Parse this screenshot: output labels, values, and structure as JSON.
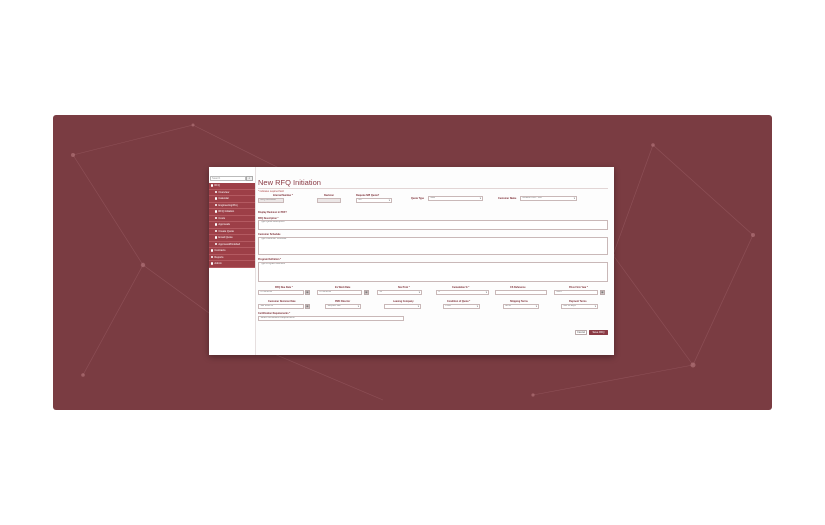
{
  "sidebar": {
    "search_placeholder": "Search",
    "search_icon": "search-icon",
    "items": [
      {
        "label": "RFQ",
        "top": true
      },
      {
        "label": "Overview",
        "top": false
      },
      {
        "label": "Calendar",
        "top": false
      },
      {
        "label": "Engineering/Proj",
        "top": false
      },
      {
        "label": "RFQ Initiation",
        "top": false
      },
      {
        "label": "Costs",
        "top": false
      },
      {
        "label": "Approvals",
        "top": false
      },
      {
        "label": "Create Quote",
        "top": false
      },
      {
        "label": "Email Quote",
        "top": false
      },
      {
        "label": "Approved/Finished",
        "top": false
      },
      {
        "label": "Contracts",
        "top": true
      },
      {
        "label": "Reports",
        "top": true
      },
      {
        "label": "Admin",
        "top": true
      }
    ]
  },
  "page": {
    "title": "New RFQ Initiation",
    "required_note": "* Indicates required field"
  },
  "form": {
    "internal_number": {
      "label": "Internal Number *",
      "value": "RFQ-00-00000"
    },
    "revision": {
      "label": "Revision",
      "value": ""
    },
    "requote_npi": {
      "label": "Requote NPI Quote?",
      "value": "No"
    },
    "quote_type": {
      "label": "Quote Type",
      "value": "New"
    },
    "customer_name": {
      "label": "Customer Name",
      "value": "Amazon.com - MG"
    },
    "display_revision": {
      "label": "Display Revision in PDF?"
    },
    "rfq_description": {
      "label": "RFQ Description *",
      "placeholder": "Type Quote Description"
    },
    "customer_schedule": {
      "label": "Customer Schedule",
      "placeholder": "Type Customer Schedule"
    },
    "program_definition": {
      "label": "Program Definition *",
      "placeholder": "Type Program Definition"
    },
    "rfq_due_date": {
      "label": "RFQ Due Date *",
      "value": "07/12/2016"
    },
    "ex_work_date": {
      "label": "Ex Work Date",
      "value": "07/12/2016"
    },
    "nre_prob": {
      "label": "Nre Prob *",
      "value": "50"
    },
    "cumulative": {
      "label": "Cumulative % *",
      "value": "0"
    },
    "cs_reference": {
      "label": "CS Reference",
      "value": ""
    },
    "price_firm_year": {
      "label": "Price Firm Year *",
      "value": "2016"
    },
    "customer_decision_date": {
      "label": "Customer Decision Date",
      "value": "Jan 2016 01"
    },
    "pmc_director": {
      "label": "PMC Director",
      "value": "Stephen Lee"
    },
    "leasing_company": {
      "label": "Leasing Company",
      "value": ""
    },
    "condition_of_quote": {
      "label": "Condition of Quote *",
      "value": "Price"
    },
    "shipping_terms": {
      "label": "Shipping Terms",
      "value": "EXW"
    },
    "payment_terms": {
      "label": "Payment Terms",
      "value": "Net 30 days"
    },
    "certification": {
      "label": "Certification Requirements *",
      "placeholder": "Select Certification Requirements"
    }
  },
  "actions": {
    "cancel_label": "Cancel",
    "save_label": "Save RFQ"
  },
  "colors": {
    "accent": "#8a3a44",
    "sidebar": "#9d3f47",
    "panel": "#7a3c42"
  }
}
